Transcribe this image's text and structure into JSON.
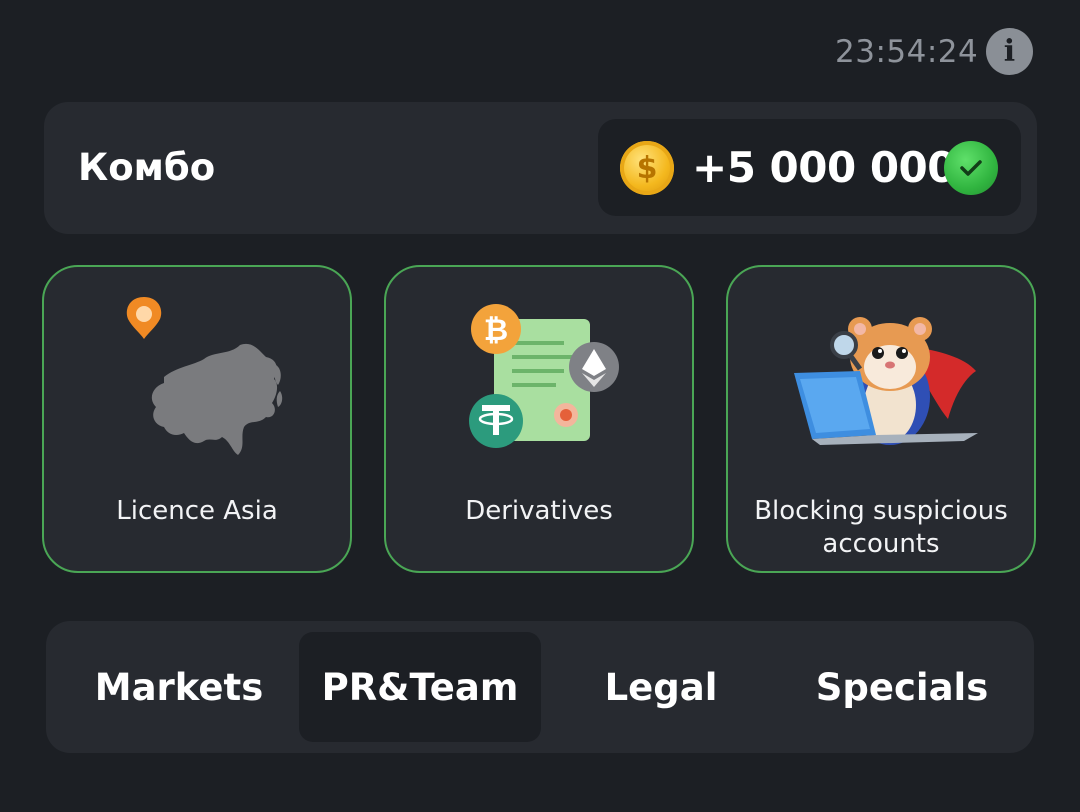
{
  "header": {
    "timer": "23:54:24",
    "info_icon": "info-icon"
  },
  "combo": {
    "title": "Комбо",
    "reward": "+5 000 000",
    "coin_symbol": "$",
    "completed": true
  },
  "cards": [
    {
      "label": "Licence Asia",
      "icon": "asia-map-pin-icon"
    },
    {
      "label": "Derivatives",
      "icon": "crypto-document-icon"
    },
    {
      "label": "Blocking suspicious accounts",
      "icon": "hamster-detective-laptop-icon"
    }
  ],
  "tabs": [
    {
      "label": "Markets",
      "active": false
    },
    {
      "label": "PR&Team",
      "active": true
    },
    {
      "label": "Legal",
      "active": false
    },
    {
      "label": "Specials",
      "active": false
    }
  ],
  "colors": {
    "background": "#1c1f24",
    "panel": "#272a30",
    "card_border": "#4aa655",
    "coin": "#f4b81e",
    "check": "#31b540"
  }
}
